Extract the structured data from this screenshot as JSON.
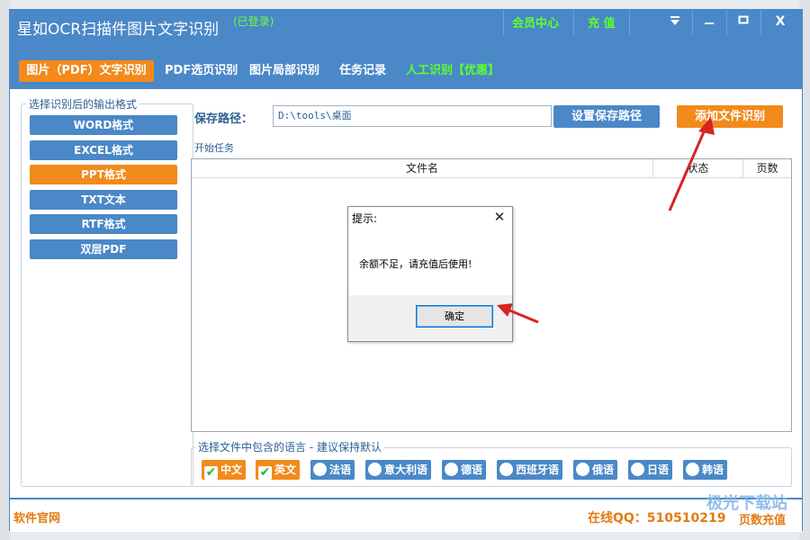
{
  "window": {
    "title": "星如OCR扫描件图片文字识别",
    "login_status": "(已登录)",
    "member_center": "会员中心",
    "recharge": "充 值",
    "controls": [
      "menu",
      "minimize",
      "maximize",
      "close"
    ],
    "close_label": "X"
  },
  "tabs": [
    {
      "label": "图片（PDF）文字识别",
      "active": true
    },
    {
      "label": "PDF选页识别",
      "active": false
    },
    {
      "label": "图片局部识别",
      "active": false
    },
    {
      "label": "任务记录",
      "active": false
    },
    {
      "label": "人工识别【优惠】",
      "active": false
    }
  ],
  "formats": {
    "legend": "选择识别后的输出格式",
    "items": [
      {
        "label": "WORD格式",
        "selected": false
      },
      {
        "label": "EXCEL格式",
        "selected": false
      },
      {
        "label": "PPT格式",
        "selected": true
      },
      {
        "label": "TXT文本",
        "selected": false
      },
      {
        "label": "RTF格式",
        "selected": false
      },
      {
        "label": "双层PDF",
        "selected": false
      }
    ]
  },
  "save": {
    "label": "保存路径：",
    "path": "D:\\tools\\桌面",
    "set_button": "设置保存路径",
    "add_button": "添加文件识别",
    "start_task": "开始任务"
  },
  "table": {
    "columns": [
      "文件名",
      "状态",
      "页数"
    ],
    "rows": []
  },
  "languages": {
    "legend": "选择文件中包含的语言 - 建议保持默认",
    "items": [
      {
        "label": "中文",
        "checked": true
      },
      {
        "label": "英文",
        "checked": true
      },
      {
        "label": "法语",
        "checked": false
      },
      {
        "label": "意大利语",
        "checked": false
      },
      {
        "label": "德语",
        "checked": false
      },
      {
        "label": "西班牙语",
        "checked": false
      },
      {
        "label": "俄语",
        "checked": false
      },
      {
        "label": "日语",
        "checked": false
      },
      {
        "label": "韩语",
        "checked": false
      }
    ]
  },
  "footer": {
    "official_site": "软件官网",
    "qq": "在线QQ：510510219",
    "page_recharge": "页数充值"
  },
  "watermark": "极光下载站",
  "dialog": {
    "title": "提示:",
    "message": "余额不足，请充值后使用!",
    "ok_label": "确定",
    "close_label": "✕"
  },
  "colors": {
    "primary_blue": "#4a88c8",
    "accent_orange": "#f28a1c",
    "highlight_green": "#5dff2f",
    "arrow_red": "#d42424"
  }
}
